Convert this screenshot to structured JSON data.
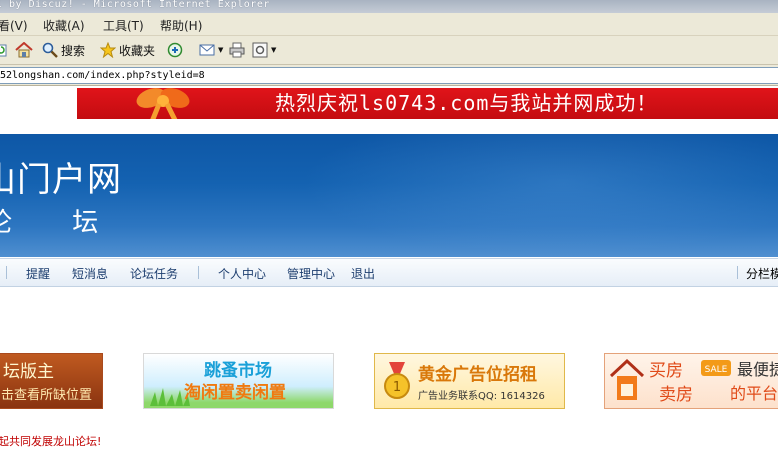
{
  "window": {
    "title": "l by Discuz! - Microsoft Internet Explorer"
  },
  "menu": {
    "items": [
      "看(V)",
      "收藏(A)",
      "工具(T)",
      "帮助(H)"
    ]
  },
  "toolbar": {
    "search_label": "搜索",
    "favorites_label": "收藏夹"
  },
  "address": {
    "url": "52longshan.com/index.php?styleid=8"
  },
  "promo": {
    "text": "热烈庆祝ls0743.com与我站并网成功！"
  },
  "banner": {
    "title": "山门户网",
    "subtitle": "论 坛"
  },
  "nav": {
    "items": [
      "提醒",
      "短消息",
      "论坛任务",
      "个人中心",
      "管理中心",
      "退出"
    ],
    "right_label": "分栏模"
  },
  "ads": {
    "ad1": {
      "line1": "坛版主",
      "line2": "击查看所缺位置"
    },
    "ad2": {
      "line1": "跳蚤市场",
      "line2": "淘闲置卖闲置"
    },
    "ad3": {
      "line1": "黄金广告位招租",
      "line2": "广告业务联系QQ: 1614326"
    },
    "ad4": {
      "line1": "买房",
      "line2": "卖房",
      "line3": "最便捷",
      "line4": "的平台"
    }
  },
  "footer": {
    "text": "起共同发展龙山论坛!"
  },
  "colors": {
    "promo_red": "#d4101a",
    "banner_blue": "#1462b1",
    "nav_text": "#1d3e6f",
    "footer_red": "#c00000"
  }
}
